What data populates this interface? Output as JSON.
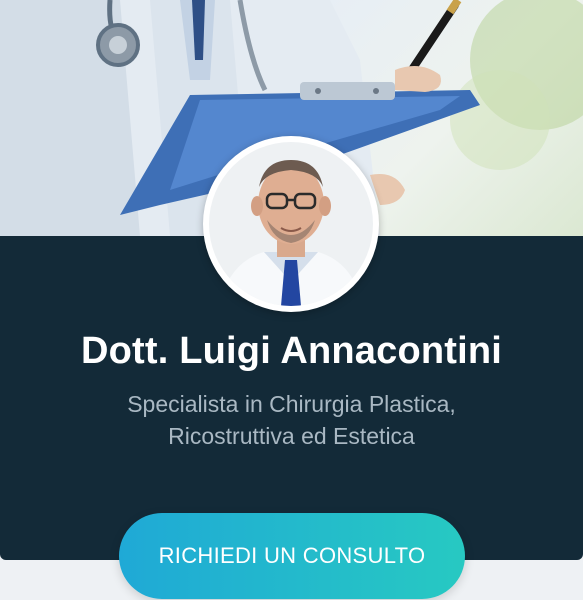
{
  "profile": {
    "name": "Dott. Luigi Annacontini",
    "subtitle_line1": "Specialista in Chirurgia Plastica,",
    "subtitle_line2": "Ricostruttiva ed Estetica"
  },
  "cta": {
    "label": "RICHIEDI UN CONSULTO"
  },
  "colors": {
    "card_background": "#132a38",
    "subtitle_text": "#a9b8c3",
    "button_gradient_start": "#1fa9d6",
    "button_gradient_end": "#27c9c2",
    "page_background": "#eef1f4"
  },
  "icons": {
    "hero_image": "doctor-with-stethoscope-and-clipboard-photo",
    "avatar": "doctor-portrait-photo"
  }
}
